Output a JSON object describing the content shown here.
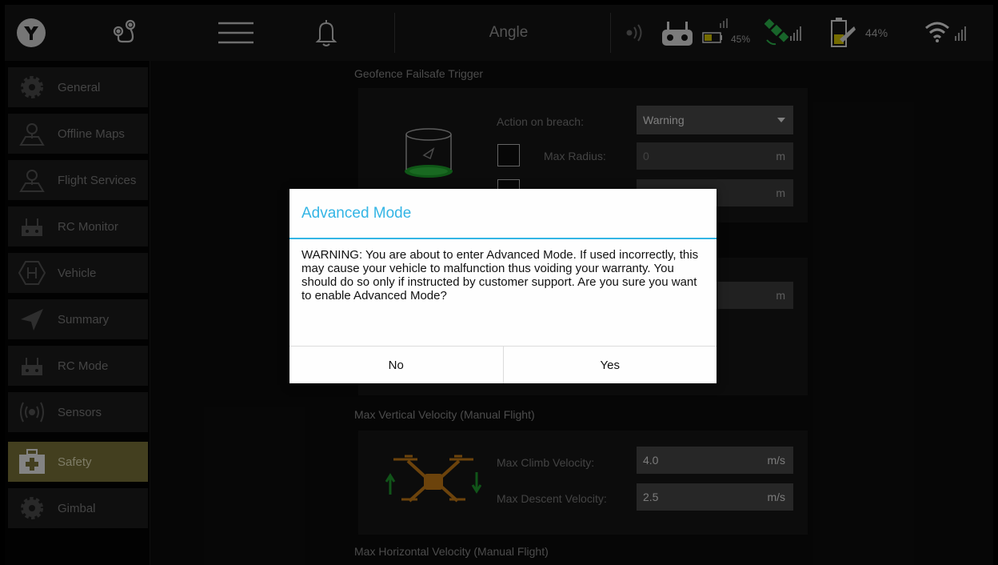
{
  "topbar": {
    "flight_mode": "Angle",
    "rc_battery_pct": "45%",
    "battery_pct": "44%",
    "icons": [
      "logo-icon",
      "route-icon",
      "menu-icon",
      "bell-icon",
      "signal-icon",
      "remote-controller-icon",
      "satellite-icon",
      "battery-icon",
      "wifi-icon"
    ]
  },
  "sidebar": {
    "items": [
      {
        "label": "General",
        "icon": "gear-icon"
      },
      {
        "label": "Offline Maps",
        "icon": "map-pin-icon"
      },
      {
        "label": "Flight Services",
        "icon": "map-pin-icon"
      },
      {
        "label": "RC Monitor",
        "icon": "remote-controller-icon"
      },
      {
        "label": "Vehicle",
        "icon": "helipad-icon"
      },
      {
        "label": "Summary",
        "icon": "paper-plane-icon"
      },
      {
        "label": "RC Mode",
        "icon": "remote-controller-icon"
      },
      {
        "label": "Sensors",
        "icon": "sensor-icon"
      },
      {
        "label": "Safety",
        "icon": "first-aid-kit-icon"
      },
      {
        "label": "Gimbal",
        "icon": "gear-icon"
      }
    ],
    "active": "Safety"
  },
  "geofence": {
    "title": "Geofence Failsafe Trigger",
    "action_label": "Action on breach:",
    "action_value": "Warning",
    "max_radius_label": "Max Radius:",
    "max_radius_value": "0",
    "max_radius_unit": "m",
    "max_altitude_unit": "m"
  },
  "rth": {
    "unit": "m"
  },
  "vertical_velocity": {
    "title": "Max Vertical Velocity (Manual Flight)",
    "climb_label": "Max Climb Velocity:",
    "climb_value": "4.0",
    "climb_unit": "m/s",
    "descent_label": "Max Descent Velocity:",
    "descent_value": "2.5",
    "descent_unit": "m/s"
  },
  "horizontal_velocity": {
    "title": "Max Horizontal Velocity (Manual Flight)"
  },
  "dialog": {
    "title": "Advanced Mode",
    "message": "WARNING: You are about to enter Advanced Mode. If used incorrectly, this may cause your vehicle to malfunction thus voiding your warranty. You should do so only if instructed by customer support. Are you sure you want to enable Advanced Mode?",
    "no_label": "No",
    "yes_label": "Yes",
    "accent_color": "#33b5e5"
  }
}
